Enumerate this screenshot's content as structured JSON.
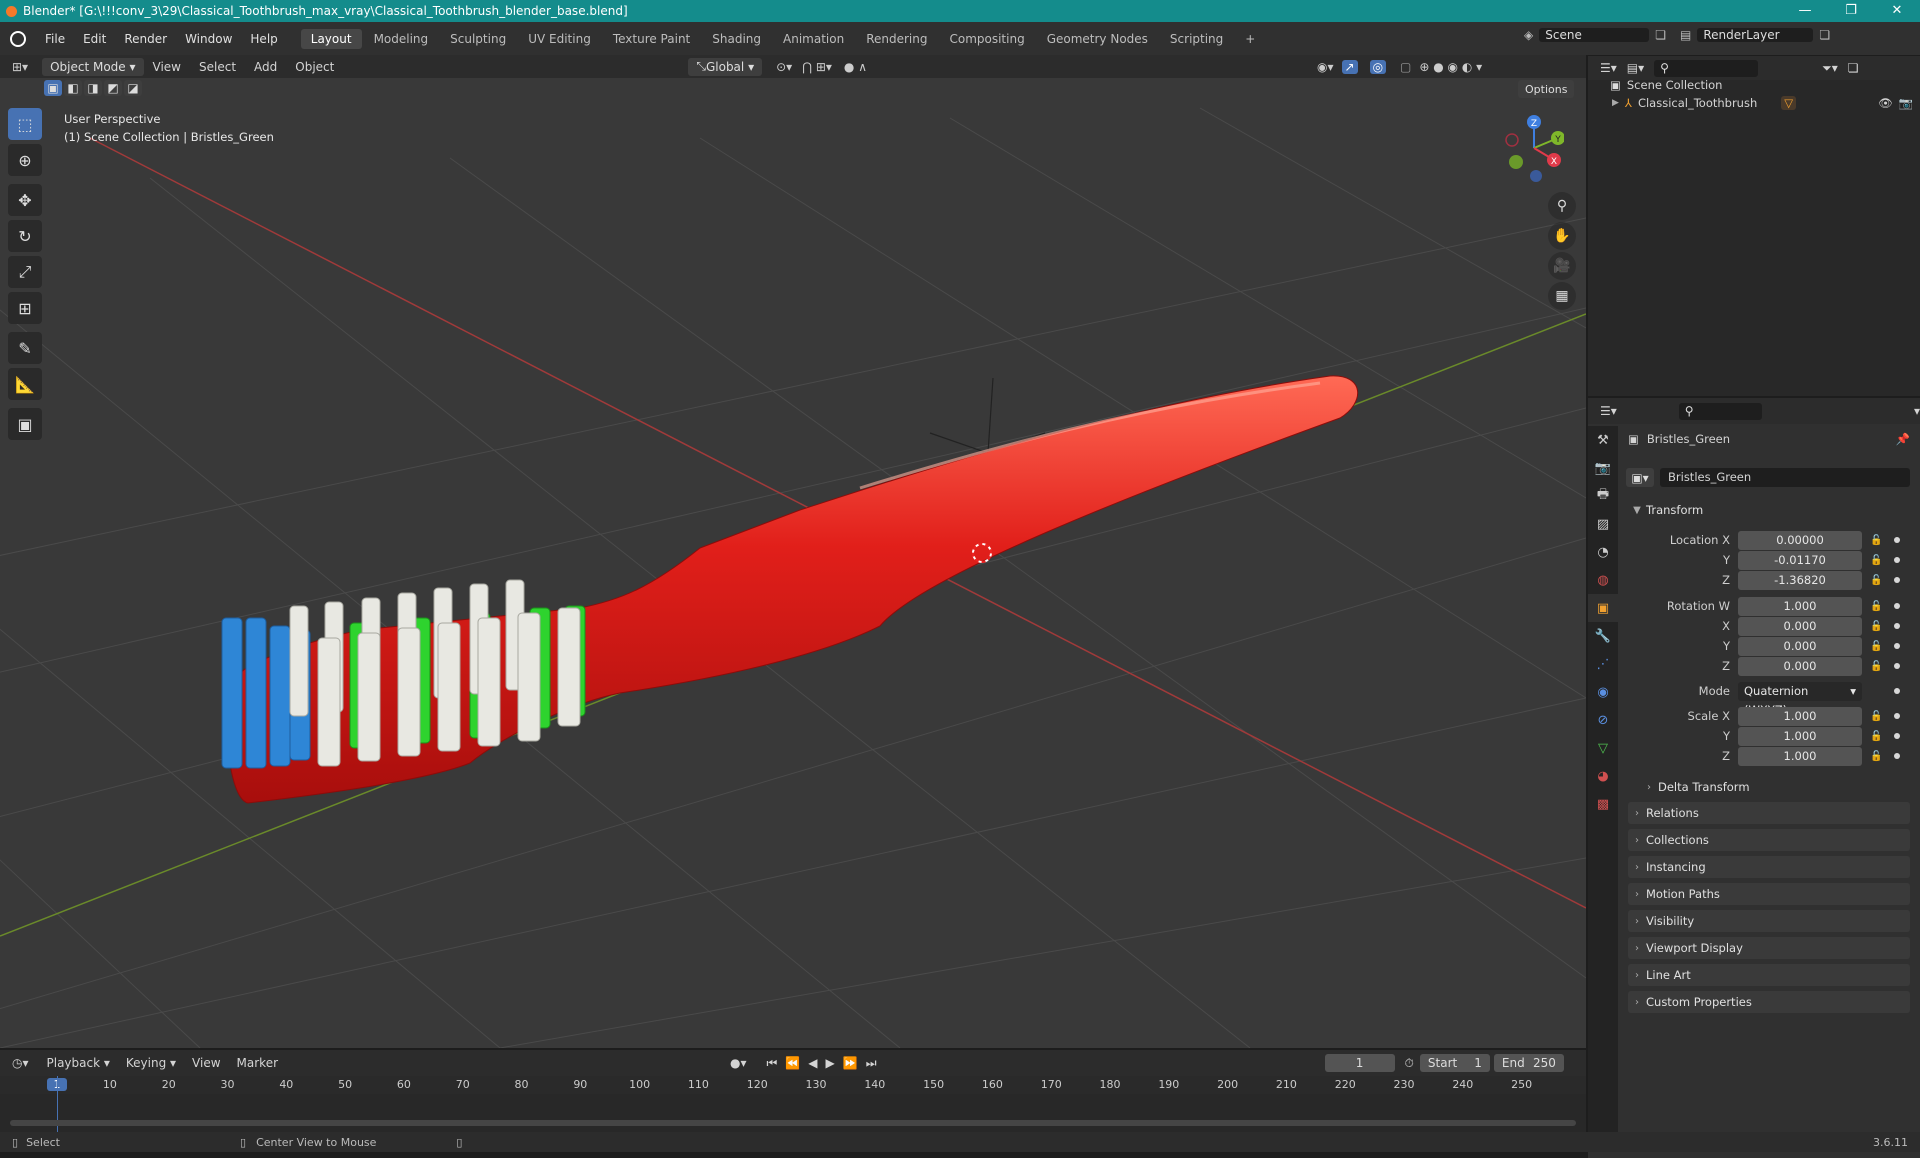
{
  "titlebar": {
    "title": "Blender* [G:\\!!!conv_3\\29\\Classical_Toothbrush_max_vray\\Classical_Toothbrush_blender_base.blend]",
    "minimize": "—",
    "maximize": "❐",
    "close": "✕"
  },
  "menu": [
    "File",
    "Edit",
    "Render",
    "Window",
    "Help"
  ],
  "workspaces": [
    "Layout",
    "Modeling",
    "Sculpting",
    "UV Editing",
    "Texture Paint",
    "Shading",
    "Animation",
    "Rendering",
    "Compositing",
    "Geometry Nodes",
    "Scripting"
  ],
  "add_workspace": "+",
  "scene": "Scene",
  "render_layer": "RenderLayer",
  "viewport_header": {
    "mode": "Object Mode",
    "menus": [
      "View",
      "Select",
      "Add",
      "Object"
    ],
    "orientation": "Global",
    "options": "Options"
  },
  "viewport": {
    "perspective": "User Perspective",
    "context": "(1) Scene Collection | Bristles_Green"
  },
  "gizmo": {
    "z": "Z",
    "y": "Y",
    "x": "X"
  },
  "outliner": {
    "root": "Scene Collection",
    "item": "Classical_Toothbrush"
  },
  "properties": {
    "object_name": "Bristles_Green",
    "datablock": "Bristles_Green",
    "transform_label": "Transform",
    "location": {
      "label": "Location X",
      "x": "0.00000",
      "y": "-0.01170",
      "z": "-1.36820"
    },
    "rotation": {
      "label": "Rotation W",
      "w": "1.000",
      "x": "0.000",
      "y": "0.000",
      "z": "0.000"
    },
    "mode_label": "Mode",
    "mode_value": "Quaternion (WXYZ)",
    "scale": {
      "label": "Scale X",
      "x": "1.000",
      "y": "1.000",
      "z": "1.000"
    },
    "axis_y": "Y",
    "axis_z": "Z",
    "axis_x": "X",
    "delta": "Delta Transform",
    "panels": [
      "Relations",
      "Collections",
      "Instancing",
      "Motion Paths",
      "Visibility",
      "Viewport Display",
      "Line Art",
      "Custom Properties"
    ]
  },
  "timeline": {
    "menus": [
      "Playback",
      "Keying",
      "View",
      "Marker"
    ],
    "current_frame": "1",
    "start_label": "Start",
    "start": "1",
    "end_label": "End",
    "end": "250",
    "ticks": [
      "1",
      "10",
      "20",
      "30",
      "40",
      "50",
      "60",
      "70",
      "80",
      "90",
      "100",
      "110",
      "120",
      "130",
      "140",
      "150",
      "160",
      "170",
      "180",
      "190",
      "200",
      "210",
      "220",
      "230",
      "240",
      "250"
    ]
  },
  "status": {
    "select": "Select",
    "center": "Center View to Mouse",
    "version": "3.6.11"
  }
}
